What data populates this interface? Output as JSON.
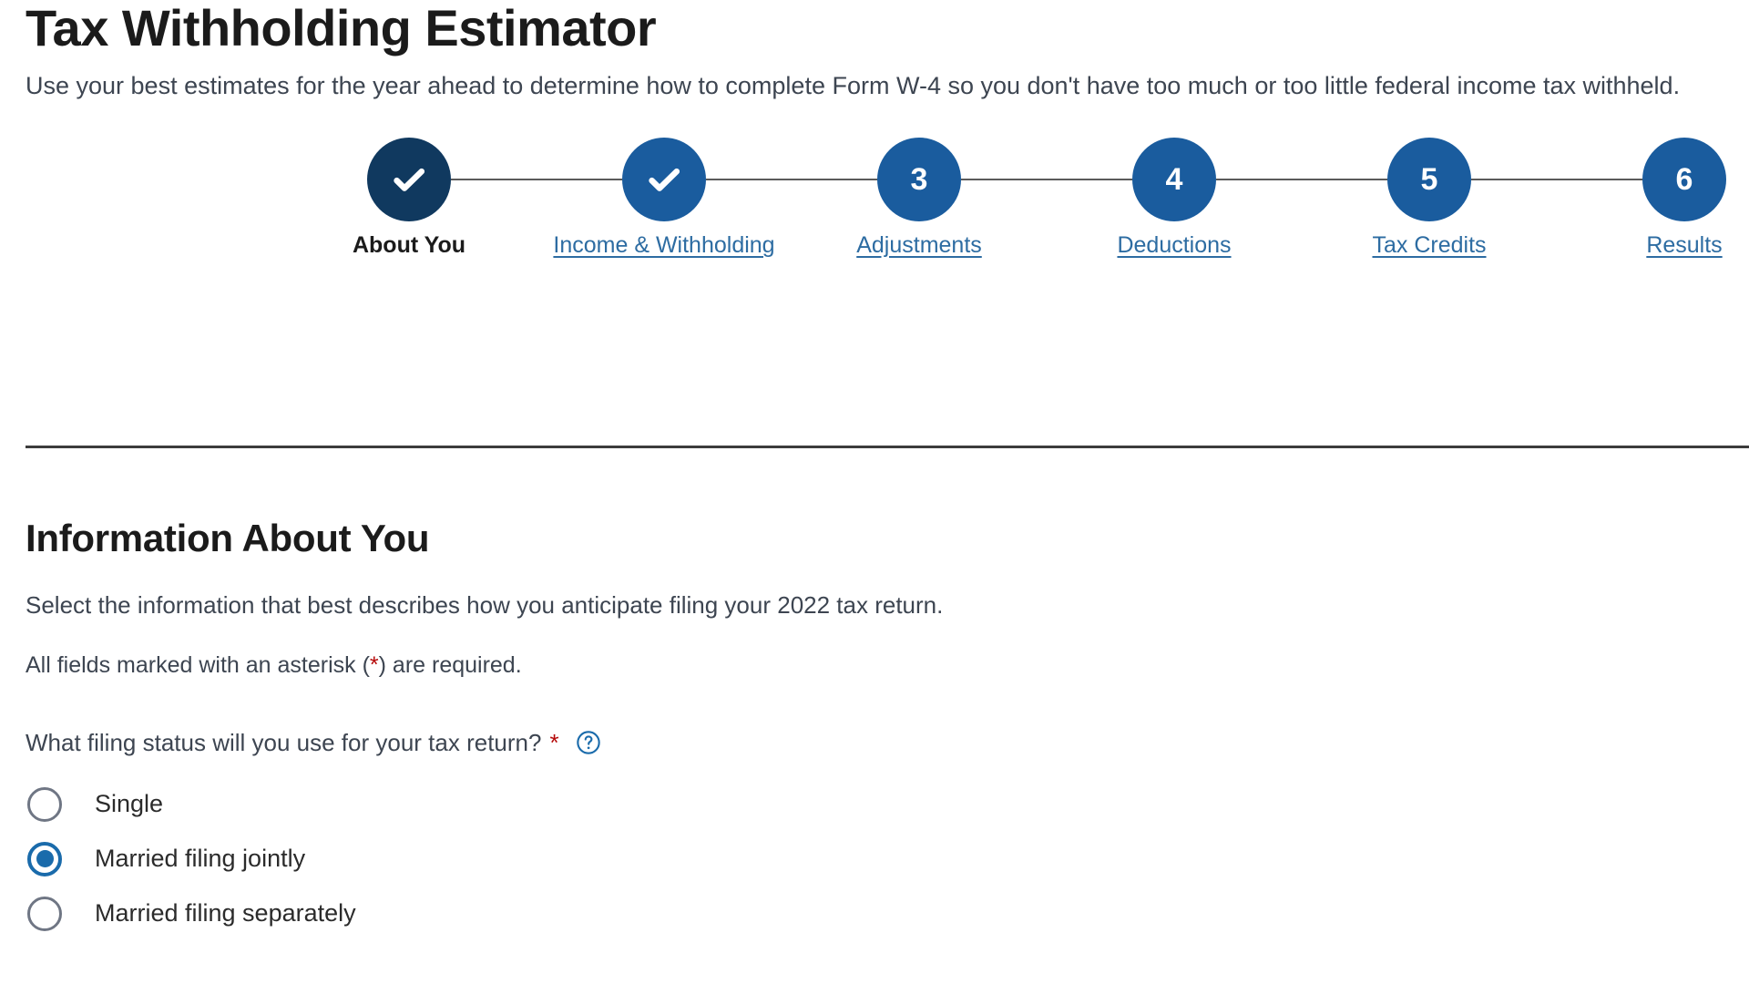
{
  "header": {
    "title": "Tax Withholding Estimator",
    "intro": "Use your best estimates for the year ahead to determine how to complete Form W-4 so you don't have too much or too little federal income tax withheld."
  },
  "stepper": {
    "steps": [
      {
        "number": "1",
        "label": "About You",
        "state": "current",
        "marker": "check"
      },
      {
        "number": "2",
        "label": "Income & Withholding",
        "state": "complete",
        "marker": "check"
      },
      {
        "number": "3",
        "label": "Adjustments",
        "state": "upcoming",
        "marker": "number"
      },
      {
        "number": "4",
        "label": "Deductions",
        "state": "upcoming",
        "marker": "number"
      },
      {
        "number": "5",
        "label": "Tax Credits",
        "state": "upcoming",
        "marker": "number"
      },
      {
        "number": "6",
        "label": "Results",
        "state": "upcoming",
        "marker": "number"
      }
    ],
    "colors": {
      "current": "#10395f",
      "other": "#1a5c9e",
      "link": "#2d6ca2",
      "connector": "#5b5b5b"
    }
  },
  "section": {
    "title": "Information About You",
    "description": "Select the information that best describes how you anticipate filing your 2022 tax return.",
    "required_note_before": "All fields marked with an asterisk (",
    "required_note_star": "*",
    "required_note_after": ") are required.",
    "tax_year": "2022"
  },
  "filing_status": {
    "question": "What filing status will you use for your tax return?",
    "required_star": "*",
    "help_icon": "question-circle-icon",
    "options": [
      {
        "label": "Single",
        "selected": false
      },
      {
        "label": "Married filing jointly",
        "selected": true
      },
      {
        "label": "Married filing separately",
        "selected": false
      }
    ],
    "selected_value": "Married filing jointly"
  },
  "colors": {
    "accent_blue": "#1a6bab",
    "navy": "#10395f",
    "required_red": "#b50909",
    "body_text": "#3d4551",
    "heading_text": "#1b1b1b",
    "background": "#ffffff"
  }
}
